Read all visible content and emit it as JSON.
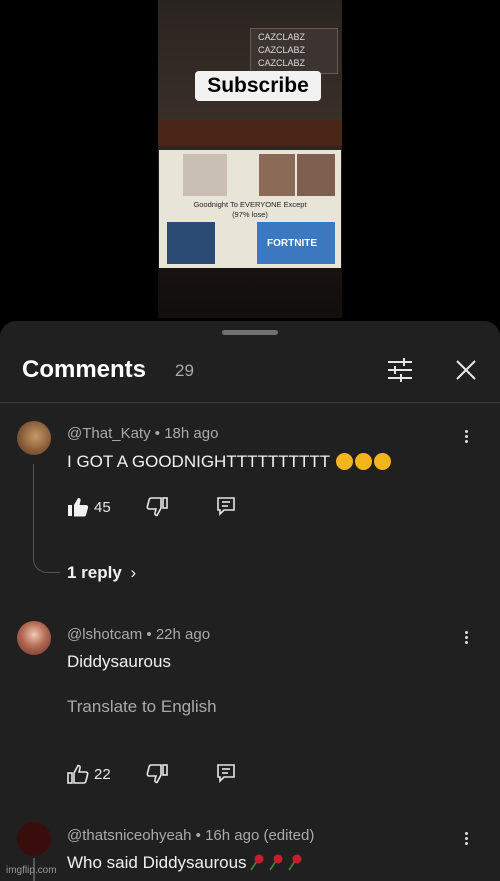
{
  "video": {
    "social_handles": [
      "CAZCLABZ",
      "CAZCLABZ",
      "CAZCLABZ"
    ],
    "subscribe_label": "Subscribe",
    "poster_caption_1": "Goodnight To EVERYONE Except",
    "poster_caption_2": "(97% lose)",
    "poster_game_label": "FORTNITE"
  },
  "header": {
    "title": "Comments",
    "count": "29",
    "filter_icon": "sliders-icon",
    "close_icon": "close-icon"
  },
  "comments": [
    {
      "author": "@That_Katy",
      "age": "18h ago",
      "text": "I GOT A GOODNIGHTTTTTTTTTT",
      "likes": "45",
      "replies_label": "1 reply",
      "like_icon": "thumbs-up-filled-icon"
    },
    {
      "author": "@lshotcam",
      "age": "22h ago",
      "text": "Diddysaurous",
      "translate_label": "Translate to English",
      "likes": "22",
      "like_icon": "thumbs-up-outline-icon"
    },
    {
      "author": "@thatsniceohyeah",
      "age": "16h ago (edited)",
      "text": "Who said Diddysaurous"
    }
  ],
  "colors": {
    "sheet_bg": "#202020",
    "text": "#f1f1f1",
    "muted": "#aaaaaa"
  },
  "watermark": "imgflip.com"
}
